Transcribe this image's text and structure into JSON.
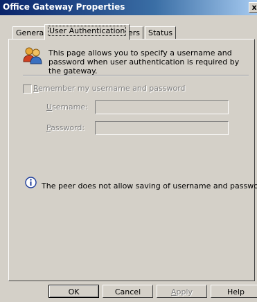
{
  "window": {
    "title": "Office Gateway Properties",
    "close_label": "x"
  },
  "tabs": [
    {
      "label": "General"
    },
    {
      "label": "User Authentication"
    },
    {
      "label": "Peers"
    },
    {
      "label": "Status"
    }
  ],
  "info": {
    "icon": "users-icon",
    "text": "This page allows you to specify a username and password when user authentication is required by the gateway."
  },
  "remember": {
    "label_first": "R",
    "label_rest": "emember my username and password",
    "checked": false
  },
  "username": {
    "label_first": "U",
    "label_rest": "sername:",
    "value": ""
  },
  "password": {
    "label_first": "P",
    "label_rest": "assword:",
    "value": ""
  },
  "notice": {
    "icon": "info-icon",
    "text": "The peer does not allow saving of username and password"
  },
  "buttons": {
    "ok": "OK",
    "cancel": "Cancel",
    "apply_first": "A",
    "apply_rest": "pply",
    "help": "Help"
  }
}
